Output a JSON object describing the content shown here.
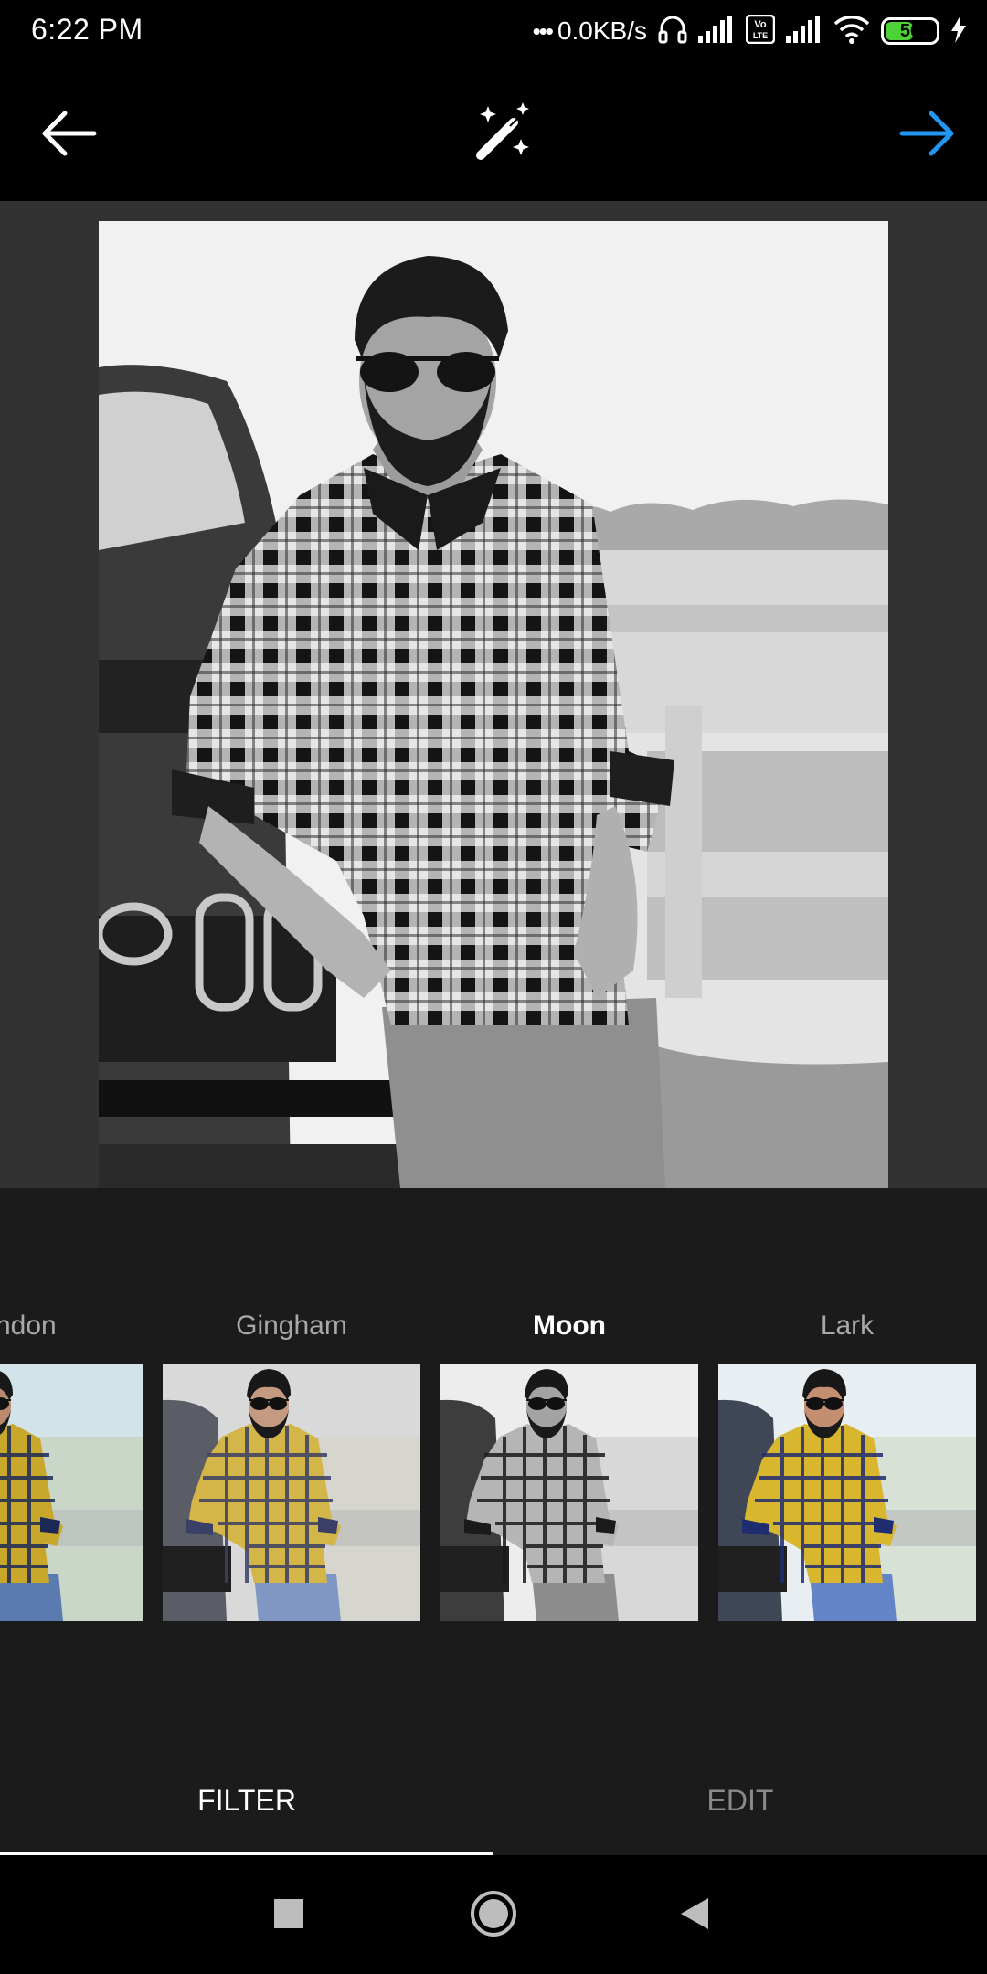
{
  "status_bar": {
    "time": "6:22 PM",
    "net_speed": "0.0KB/s",
    "battery_level": "56",
    "volte_label": "Vo LTE",
    "icons": [
      "headphones-icon",
      "signal-icon",
      "volte-icon",
      "signal-icon",
      "wifi-icon",
      "battery-icon",
      "charging-icon"
    ]
  },
  "toolbar": {
    "back_icon": "arrow-left-icon",
    "magic_icon": "magic-wand-icon",
    "next_icon": "arrow-right-icon",
    "next_color": "#2196f3"
  },
  "filters": [
    {
      "label": "Clarendon",
      "visible_label": "rendon",
      "tone": "color"
    },
    {
      "label": "Gingham",
      "tone": "faded"
    },
    {
      "label": "Moon",
      "tone": "mono",
      "selected": true
    },
    {
      "label": "Lark",
      "tone": "bright"
    }
  ],
  "tabs": {
    "filter": "FILTER",
    "edit": "EDIT",
    "active": "filter"
  },
  "nav_bar": {
    "icons": [
      "recents-square-icon",
      "home-circle-icon",
      "back-triangle-icon"
    ]
  }
}
